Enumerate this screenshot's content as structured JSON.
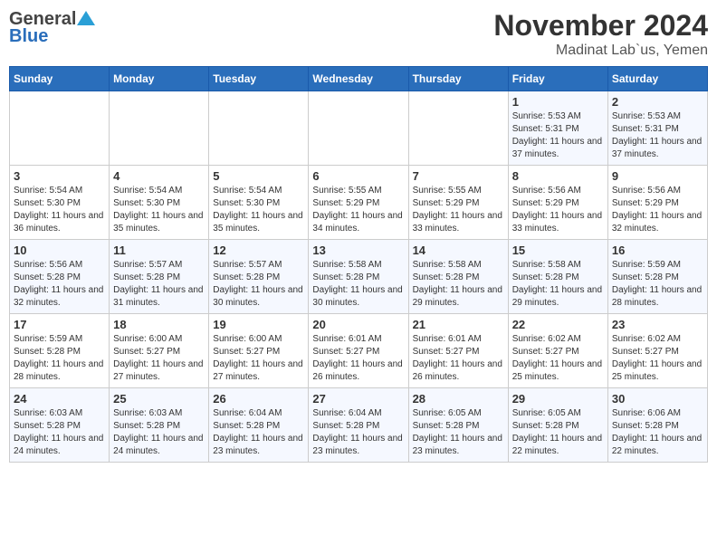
{
  "header": {
    "logo_general": "General",
    "logo_blue": "Blue",
    "title": "November 2024",
    "location": "Madinat Lab`us, Yemen"
  },
  "calendar": {
    "days_of_week": [
      "Sunday",
      "Monday",
      "Tuesday",
      "Wednesday",
      "Thursday",
      "Friday",
      "Saturday"
    ],
    "weeks": [
      [
        {
          "day": "",
          "info": ""
        },
        {
          "day": "",
          "info": ""
        },
        {
          "day": "",
          "info": ""
        },
        {
          "day": "",
          "info": ""
        },
        {
          "day": "",
          "info": ""
        },
        {
          "day": "1",
          "info": "Sunrise: 5:53 AM\nSunset: 5:31 PM\nDaylight: 11 hours and 37 minutes."
        },
        {
          "day": "2",
          "info": "Sunrise: 5:53 AM\nSunset: 5:31 PM\nDaylight: 11 hours and 37 minutes."
        }
      ],
      [
        {
          "day": "3",
          "info": "Sunrise: 5:54 AM\nSunset: 5:30 PM\nDaylight: 11 hours and 36 minutes."
        },
        {
          "day": "4",
          "info": "Sunrise: 5:54 AM\nSunset: 5:30 PM\nDaylight: 11 hours and 35 minutes."
        },
        {
          "day": "5",
          "info": "Sunrise: 5:54 AM\nSunset: 5:30 PM\nDaylight: 11 hours and 35 minutes."
        },
        {
          "day": "6",
          "info": "Sunrise: 5:55 AM\nSunset: 5:29 PM\nDaylight: 11 hours and 34 minutes."
        },
        {
          "day": "7",
          "info": "Sunrise: 5:55 AM\nSunset: 5:29 PM\nDaylight: 11 hours and 33 minutes."
        },
        {
          "day": "8",
          "info": "Sunrise: 5:56 AM\nSunset: 5:29 PM\nDaylight: 11 hours and 33 minutes."
        },
        {
          "day": "9",
          "info": "Sunrise: 5:56 AM\nSunset: 5:29 PM\nDaylight: 11 hours and 32 minutes."
        }
      ],
      [
        {
          "day": "10",
          "info": "Sunrise: 5:56 AM\nSunset: 5:28 PM\nDaylight: 11 hours and 32 minutes."
        },
        {
          "day": "11",
          "info": "Sunrise: 5:57 AM\nSunset: 5:28 PM\nDaylight: 11 hours and 31 minutes."
        },
        {
          "day": "12",
          "info": "Sunrise: 5:57 AM\nSunset: 5:28 PM\nDaylight: 11 hours and 30 minutes."
        },
        {
          "day": "13",
          "info": "Sunrise: 5:58 AM\nSunset: 5:28 PM\nDaylight: 11 hours and 30 minutes."
        },
        {
          "day": "14",
          "info": "Sunrise: 5:58 AM\nSunset: 5:28 PM\nDaylight: 11 hours and 29 minutes."
        },
        {
          "day": "15",
          "info": "Sunrise: 5:58 AM\nSunset: 5:28 PM\nDaylight: 11 hours and 29 minutes."
        },
        {
          "day": "16",
          "info": "Sunrise: 5:59 AM\nSunset: 5:28 PM\nDaylight: 11 hours and 28 minutes."
        }
      ],
      [
        {
          "day": "17",
          "info": "Sunrise: 5:59 AM\nSunset: 5:28 PM\nDaylight: 11 hours and 28 minutes."
        },
        {
          "day": "18",
          "info": "Sunrise: 6:00 AM\nSunset: 5:27 PM\nDaylight: 11 hours and 27 minutes."
        },
        {
          "day": "19",
          "info": "Sunrise: 6:00 AM\nSunset: 5:27 PM\nDaylight: 11 hours and 27 minutes."
        },
        {
          "day": "20",
          "info": "Sunrise: 6:01 AM\nSunset: 5:27 PM\nDaylight: 11 hours and 26 minutes."
        },
        {
          "day": "21",
          "info": "Sunrise: 6:01 AM\nSunset: 5:27 PM\nDaylight: 11 hours and 26 minutes."
        },
        {
          "day": "22",
          "info": "Sunrise: 6:02 AM\nSunset: 5:27 PM\nDaylight: 11 hours and 25 minutes."
        },
        {
          "day": "23",
          "info": "Sunrise: 6:02 AM\nSunset: 5:27 PM\nDaylight: 11 hours and 25 minutes."
        }
      ],
      [
        {
          "day": "24",
          "info": "Sunrise: 6:03 AM\nSunset: 5:28 PM\nDaylight: 11 hours and 24 minutes."
        },
        {
          "day": "25",
          "info": "Sunrise: 6:03 AM\nSunset: 5:28 PM\nDaylight: 11 hours and 24 minutes."
        },
        {
          "day": "26",
          "info": "Sunrise: 6:04 AM\nSunset: 5:28 PM\nDaylight: 11 hours and 23 minutes."
        },
        {
          "day": "27",
          "info": "Sunrise: 6:04 AM\nSunset: 5:28 PM\nDaylight: 11 hours and 23 minutes."
        },
        {
          "day": "28",
          "info": "Sunrise: 6:05 AM\nSunset: 5:28 PM\nDaylight: 11 hours and 23 minutes."
        },
        {
          "day": "29",
          "info": "Sunrise: 6:05 AM\nSunset: 5:28 PM\nDaylight: 11 hours and 22 minutes."
        },
        {
          "day": "30",
          "info": "Sunrise: 6:06 AM\nSunset: 5:28 PM\nDaylight: 11 hours and 22 minutes."
        }
      ]
    ]
  }
}
